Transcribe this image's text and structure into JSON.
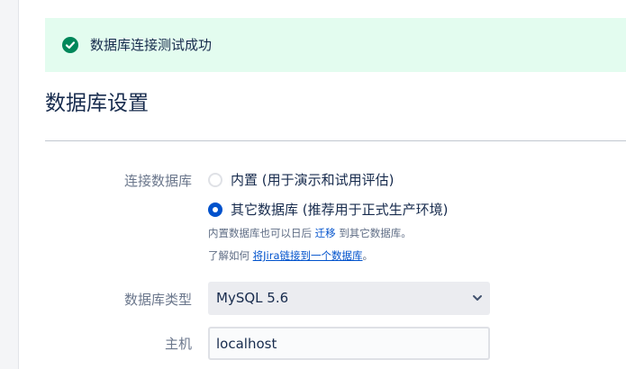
{
  "success_banner": {
    "message": "数据库连接测试成功",
    "icon": "check-circle-icon",
    "background": "#e3fcef",
    "icon_color": "#00875a"
  },
  "page_title": "数据库设置",
  "connection": {
    "label": "连接数据库",
    "options": [
      {
        "label": "内置 (用于演示和试用评估)",
        "selected": false
      },
      {
        "label": "其它数据库 (推荐用于正式生产环境)",
        "selected": true
      }
    ],
    "help1": {
      "prefix": "内置数据库也可以日后",
      "link": "迁移",
      "suffix": "到其它数据库。"
    },
    "help2": {
      "prefix": "了解如何",
      "link": "将Jira链接到一个数据库",
      "suffix": "。"
    }
  },
  "db_type": {
    "label": "数据库类型",
    "value": "MySQL 5.6"
  },
  "host": {
    "label": "主机",
    "value": "localhost"
  },
  "colors": {
    "accent": "#0052cc",
    "text": "#172b4d",
    "muted": "#6b778c"
  }
}
